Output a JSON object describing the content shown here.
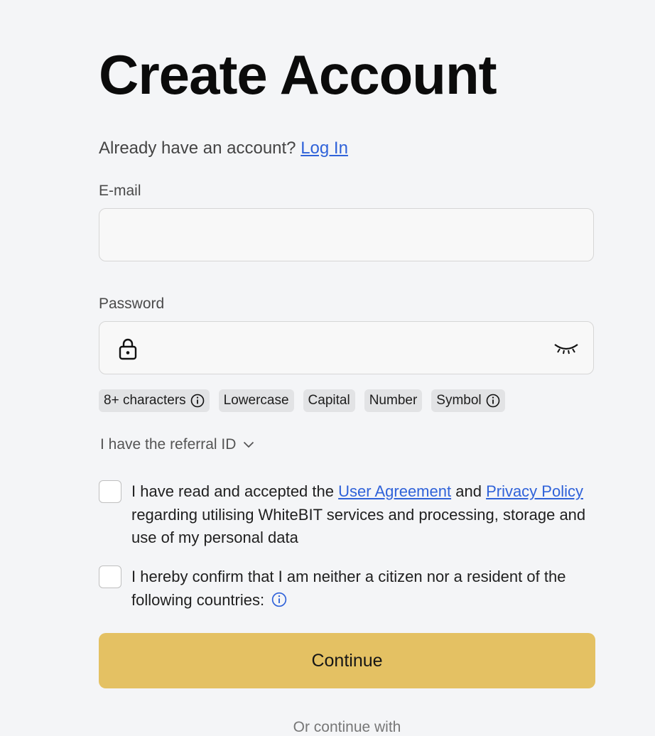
{
  "title": "Create Account",
  "login": {
    "prompt": "Already have an account?",
    "link": "Log In"
  },
  "email": {
    "label": "E-mail",
    "value": "",
    "placeholder": ""
  },
  "password": {
    "label": "Password",
    "value": "",
    "placeholder": ""
  },
  "requirements": [
    "8+ characters",
    "Lowercase",
    "Capital",
    "Number",
    "Symbol"
  ],
  "referral": {
    "label": "I have the referral ID"
  },
  "agreement": {
    "prefix": "I have read and accepted the",
    "user_agreement": "User Agreement",
    "middle": "and",
    "privacy_policy": "Privacy Policy",
    "suffix": "regarding utilising WhiteBIT services and processing, storage and use of my personal data"
  },
  "residency": {
    "text": "I hereby confirm that I am neither a citizen nor a resident of the following countries:"
  },
  "continue_label": "Continue",
  "bottom_text": "Or continue with",
  "colors": {
    "accent": "#e4c163",
    "link": "#2f62d9"
  }
}
